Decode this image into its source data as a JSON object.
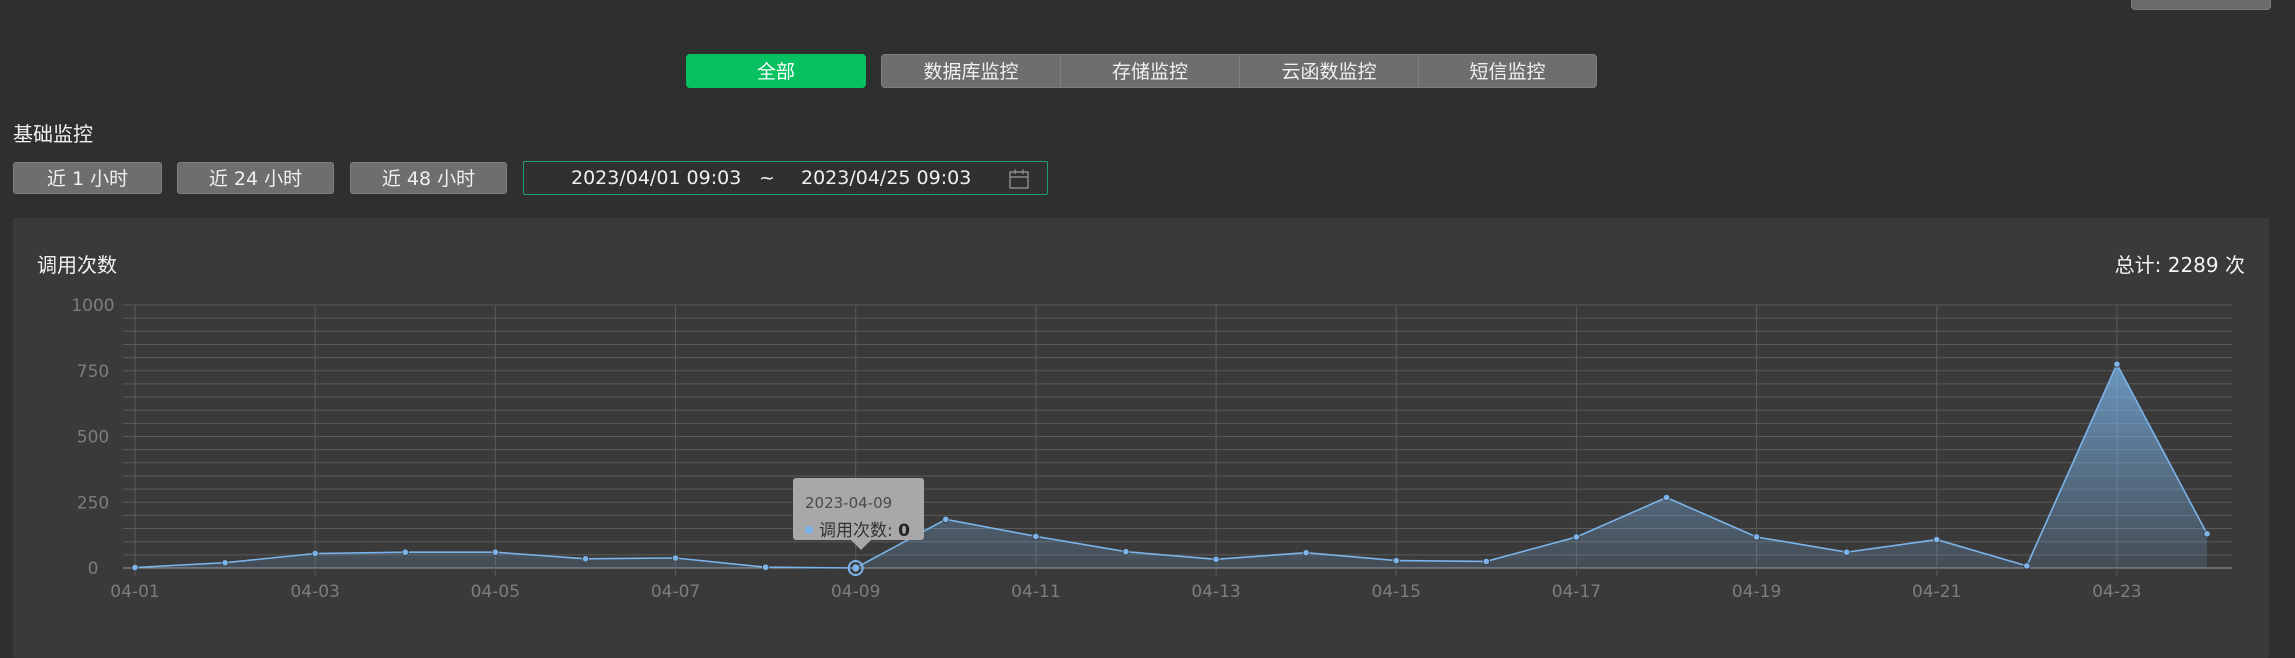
{
  "tabs": [
    {
      "label": "全部",
      "active": true
    },
    {
      "label": "数据库监控",
      "active": false
    },
    {
      "label": "存储监控",
      "active": false
    },
    {
      "label": "云函数监控",
      "active": false
    },
    {
      "label": "短信监控",
      "active": false
    }
  ],
  "section_title": "基础监控",
  "range_buttons": [
    "近 1 小时",
    "近 24 小时",
    "近 48 小时"
  ],
  "date_range": {
    "start": "2023/04/01 09:03",
    "separator": "~",
    "end": "2023/04/25 09:03"
  },
  "panel": {
    "title": "调用次数",
    "total_label": "总计: 2289 次"
  },
  "tooltip": {
    "date": "2023-04-09",
    "series": "调用次数",
    "sep": ": ",
    "value": "0"
  },
  "colors": {
    "accent": "#07c160",
    "series": "#7ab4ea"
  },
  "chart_data": {
    "type": "area",
    "title": "调用次数",
    "x": [
      "04-01",
      "04-02",
      "04-03",
      "04-04",
      "04-05",
      "04-06",
      "04-07",
      "04-08",
      "04-09",
      "04-10",
      "04-11",
      "04-12",
      "04-13",
      "04-14",
      "04-15",
      "04-16",
      "04-17",
      "04-18",
      "04-19",
      "04-20",
      "04-21",
      "04-22",
      "04-23",
      "04-24"
    ],
    "x_tick_labels": [
      "04-01",
      "04-03",
      "04-05",
      "04-07",
      "04-09",
      "04-11",
      "04-13",
      "04-15",
      "04-17",
      "04-19",
      "04-21",
      "04-23"
    ],
    "series": [
      {
        "name": "调用次数",
        "values": [
          2,
          20,
          55,
          60,
          60,
          35,
          38,
          3,
          0,
          185,
          120,
          62,
          33,
          58,
          28,
          25,
          118,
          268,
          118,
          60,
          108,
          8,
          775,
          130
        ]
      }
    ],
    "ylim": [
      0,
      1000
    ],
    "y_ticks": [
      0,
      250,
      500,
      750,
      1000
    ],
    "grid": true
  }
}
